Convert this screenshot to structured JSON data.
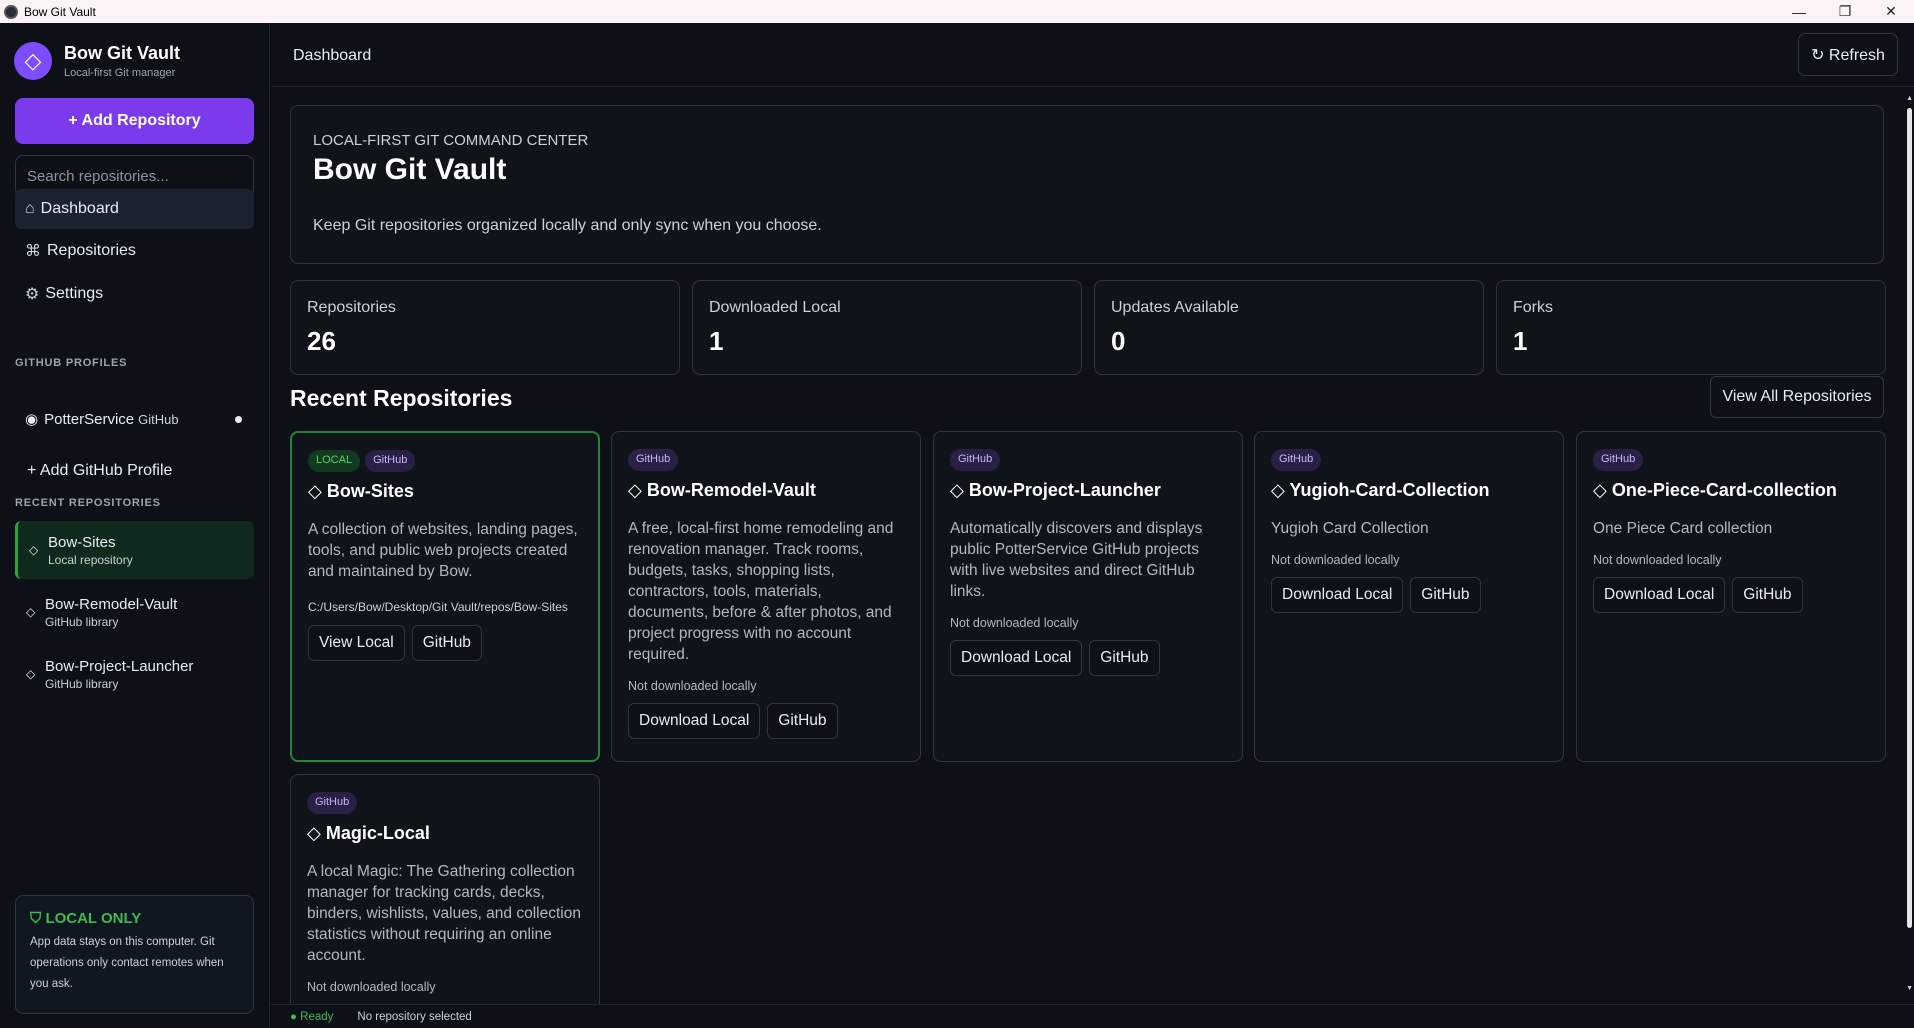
{
  "window": {
    "title": "Bow Git Vault"
  },
  "sidebar": {
    "brand_name": "Bow Git Vault",
    "brand_sub": "Local-first Git manager",
    "add_repo_label": "+ Add Repository",
    "search_placeholder": "Search repositories...",
    "nav": [
      {
        "icon": "⌂",
        "label": "Dashboard"
      },
      {
        "icon": "⌘",
        "label": "Repositories"
      },
      {
        "icon": "⚙",
        "label": "Settings"
      }
    ],
    "profiles_heading": "GITHUB PROFILES",
    "profile": {
      "name": "PotterService",
      "source": "GitHub"
    },
    "add_profile_label": "+ Add GitHub Profile",
    "recent_heading": "RECENT REPOSITORIES",
    "recent": [
      {
        "name": "Bow-Sites",
        "meta": "Local repository"
      },
      {
        "name": "Bow-Remodel-Vault",
        "meta": "GitHub library"
      },
      {
        "name": "Bow-Project-Launcher",
        "meta": "GitHub library"
      }
    ],
    "local_only": {
      "title": "LOCAL ONLY",
      "desc": "App data stays on this computer. Git operations only contact remotes when you ask."
    }
  },
  "header": {
    "title": "Dashboard",
    "refresh_label": "↻ Refresh"
  },
  "hero": {
    "eyebrow": "LOCAL-FIRST GIT COMMAND CENTER",
    "title": "Bow Git Vault",
    "desc": "Keep Git repositories organized locally and only sync when you choose."
  },
  "stats": [
    {
      "label": "Repositories",
      "value": "26"
    },
    {
      "label": "Downloaded Local",
      "value": "1"
    },
    {
      "label": "Updates Available",
      "value": "0"
    },
    {
      "label": "Forks",
      "value": "1"
    }
  ],
  "recent_section": {
    "title": "Recent Repositories",
    "view_all_label": "View All Repositories"
  },
  "cards": [
    {
      "tags": [
        "LOCAL",
        "GitHub"
      ],
      "name": "◇ Bow-Sites",
      "desc": "A collection of websites, landing pages, tools, and public web projects created and maintained by Bow.",
      "path": "C:/Users/Bow/Desktop/Git Vault/repos/Bow-Sites",
      "buttons": [
        "View Local",
        "GitHub"
      ]
    },
    {
      "tags": [
        "GitHub"
      ],
      "name": "◇ Bow-Remodel-Vault",
      "desc": "A free, local-first home remodeling and renovation manager. Track rooms, budgets, tasks, shopping lists, contractors, tools, materials, documents, before & after photos, and project progress with no account required.",
      "status": "Not downloaded locally",
      "buttons": [
        "Download Local",
        "GitHub"
      ]
    },
    {
      "tags": [
        "GitHub"
      ],
      "name": "◇ Bow-Project-Launcher",
      "desc": "Automatically discovers and displays public PotterService GitHub projects with live websites and direct GitHub links.",
      "status": "Not downloaded locally",
      "buttons": [
        "Download Local",
        "GitHub"
      ]
    },
    {
      "tags": [
        "GitHub"
      ],
      "name": "◇ Yugioh-Card-Collection",
      "desc": "Yugioh Card Collection",
      "status": "Not downloaded locally",
      "buttons": [
        "Download Local",
        "GitHub"
      ]
    },
    {
      "tags": [
        "GitHub"
      ],
      "name": "◇ One-Piece-Card-collection",
      "desc": "One Piece Card collection",
      "status": "Not downloaded locally",
      "buttons": [
        "Download Local",
        "GitHub"
      ]
    },
    {
      "tags": [
        "GitHub"
      ],
      "name": "◇ Magic-Local",
      "desc": "A local Magic: The Gathering collection manager for tracking cards, decks, binders, wishlists, values, and collection statistics without requiring an online account.",
      "status": "Not downloaded locally"
    }
  ],
  "statusbar": {
    "ready": "● Ready",
    "selection": "No repository selected"
  },
  "colors": {
    "accent": "#7c3aed",
    "success": "#3fb950",
    "background": "#0d1117"
  }
}
